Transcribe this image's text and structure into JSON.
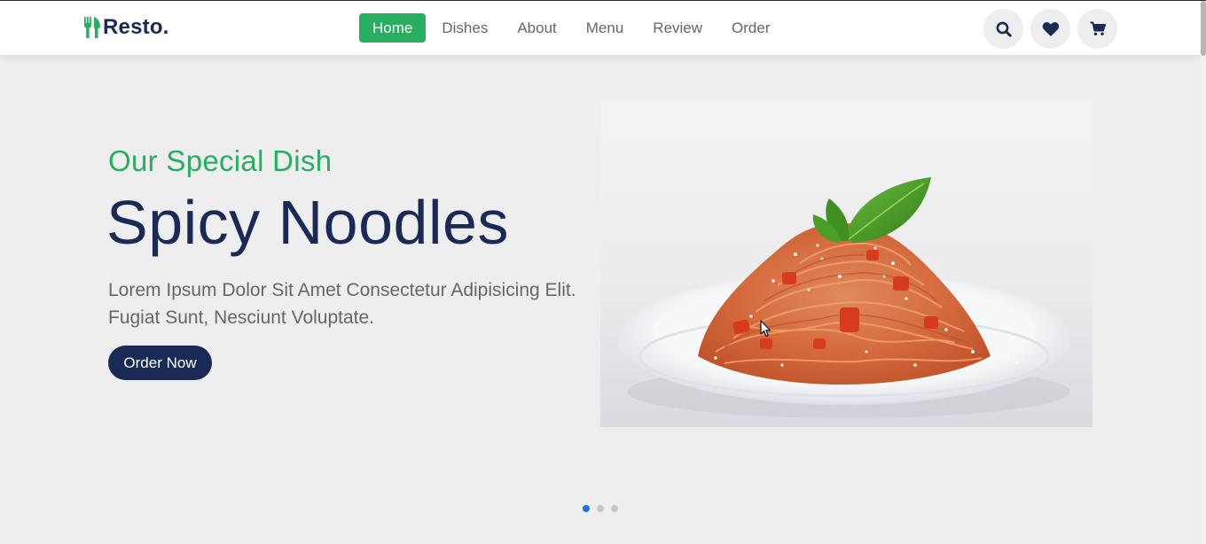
{
  "brand": {
    "name": "Resto.",
    "accent_color": "#27ae60",
    "dark_color": "#192a56",
    "logo_icon": "utensils-icon"
  },
  "nav": {
    "items": [
      {
        "label": "Home",
        "active": true
      },
      {
        "label": "Dishes",
        "active": false
      },
      {
        "label": "About",
        "active": false
      },
      {
        "label": "Menu",
        "active": false
      },
      {
        "label": "Review",
        "active": false
      },
      {
        "label": "Order",
        "active": false
      }
    ]
  },
  "header_icons": [
    "search-icon",
    "heart-icon",
    "cart-icon"
  ],
  "hero": {
    "subtitle": "Our Special Dish",
    "title": "Spicy Noodles",
    "description": "Lorem Ipsum Dolor Sit Amet Consectetur Adipisicing Elit. Fugiat Sunt, Nesciunt Voluptate.",
    "cta_label": "Order Now",
    "image": "spaghetti-plate-image"
  },
  "slider": {
    "count": 3,
    "active_index": 0
  }
}
